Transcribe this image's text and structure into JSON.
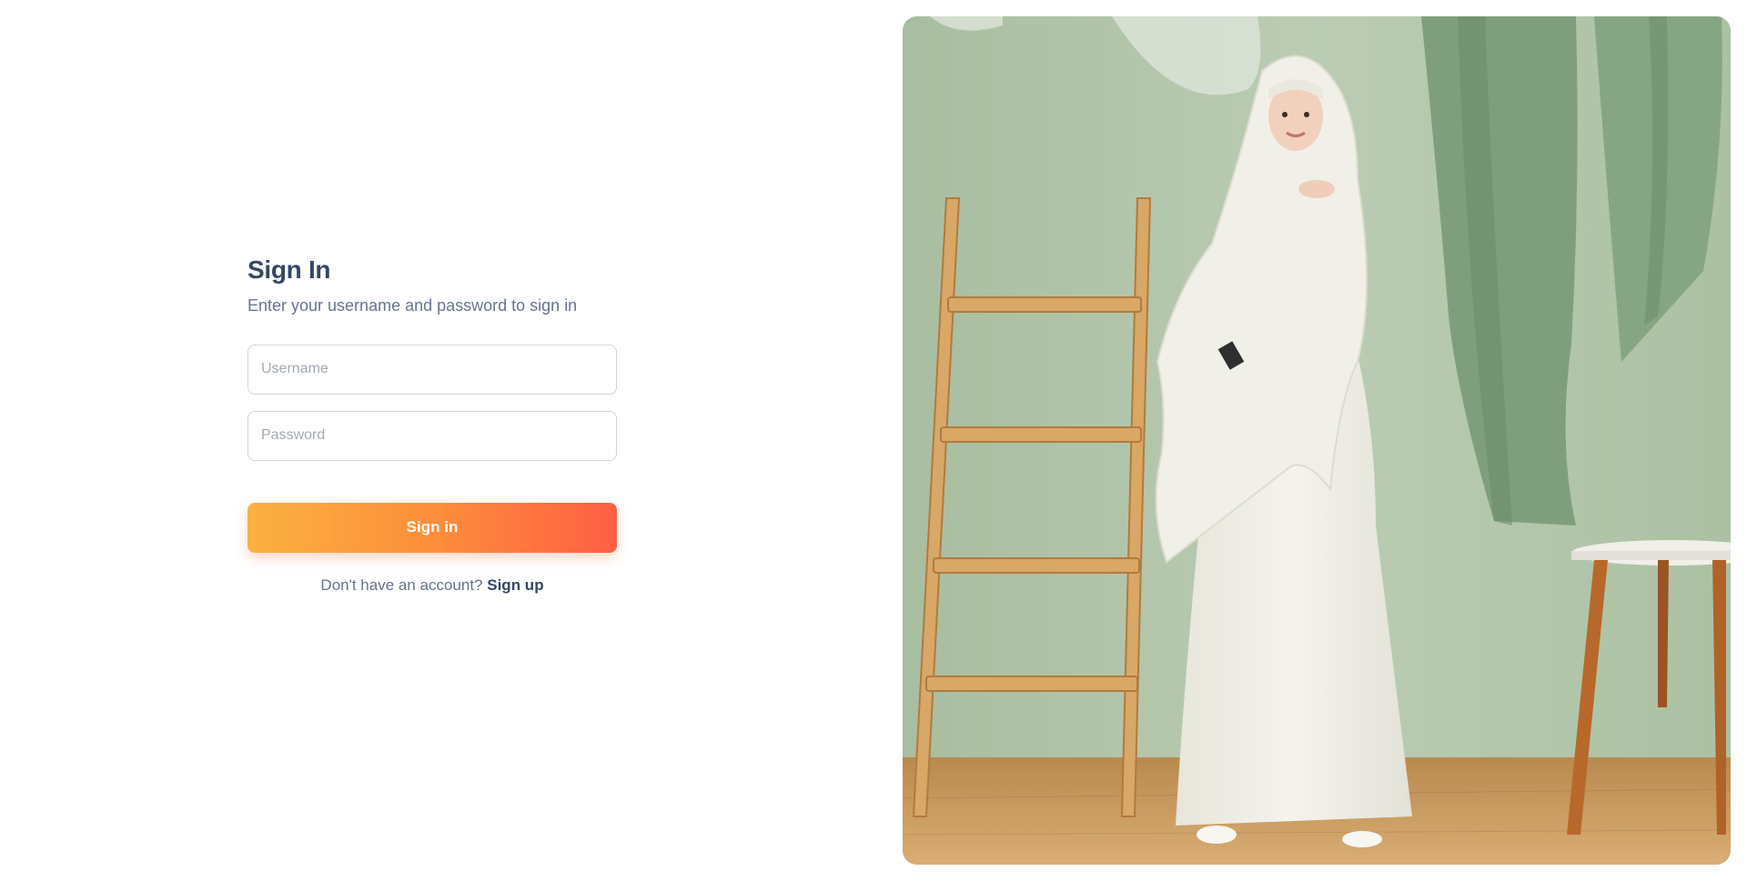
{
  "signin": {
    "title": "Sign In",
    "subtitle": "Enter your username and password to sign in",
    "username_placeholder": "Username",
    "password_placeholder": "Password",
    "submit_label": "Sign in",
    "footer_prompt": "Don't have an account?",
    "footer_link": "Sign up"
  },
  "hero": {
    "icon": "fashion-model-photo"
  },
  "colors": {
    "heading": "#344767",
    "muted": "#67748e",
    "button_gradient_start": "#fbb140",
    "button_gradient_end": "#fe5f44",
    "hero_wall": "#b0c4a8"
  }
}
